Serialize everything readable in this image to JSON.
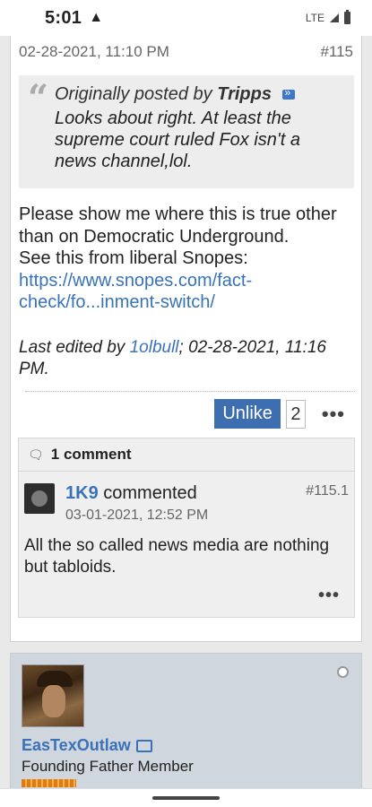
{
  "status": {
    "time": "5:01",
    "network": "LTE"
  },
  "post": {
    "date": "02-28-2021, 11:10 PM",
    "number": "#115",
    "quote": {
      "prefix": "Originally posted by",
      "author": "Tripps",
      "text": "Looks about right. At least the supreme court ruled Fox isn't a news channel,lol."
    },
    "body_line1": "Please show me where this is true other than on Democratic Underground.",
    "body_line2": "See this from liberal Snopes:",
    "link": "https://www.snopes.com/fact-check/fo...inment-switch/",
    "edited_prefix": "Last edited by",
    "edited_by": "1olbull",
    "edited_suffix": "; 02-28-2021, 11:16 PM.",
    "unlike_label": "Unlike",
    "like_count": "2",
    "more_label": "•••"
  },
  "comments": {
    "header": "1 comment",
    "items": [
      {
        "author": "1K9",
        "action": "commented",
        "number": "#115.1",
        "date": "03-01-2021, 12:52 PM",
        "text": "All the so called news media are nothing but tabloids.",
        "more_label": "•••"
      }
    ]
  },
  "next_user": {
    "name": "EasTexOutlaw",
    "title": "Founding Father Member"
  }
}
